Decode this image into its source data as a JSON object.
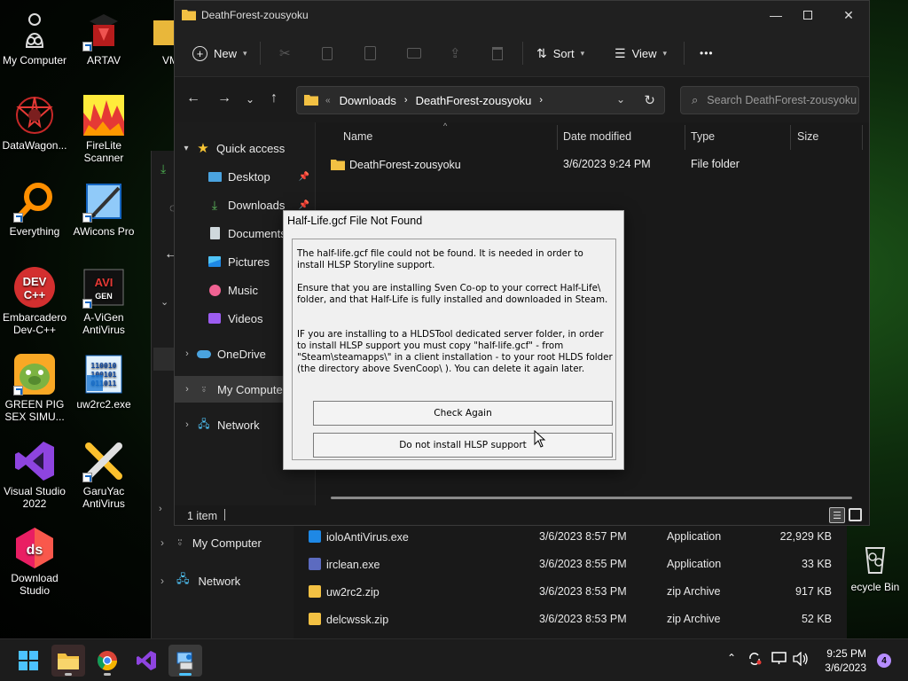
{
  "desktop": {
    "icons": [
      {
        "label": "My Computer"
      },
      {
        "label": "ARTAV"
      },
      {
        "label": "VM"
      },
      {
        "label": "DataWagon..."
      },
      {
        "label": "FireLite Scanner"
      },
      {
        "label": "Everything"
      },
      {
        "label": "AWicons Pro"
      },
      {
        "label": "Embarcadero Dev-C++"
      },
      {
        "label": "A-ViGen AntiVirus"
      },
      {
        "label": "GREEN PIG SEX SIMU..."
      },
      {
        "label": "uw2rc2.exe"
      },
      {
        "label": "Visual Studio 2022"
      },
      {
        "label": "GaruYac AntiVirus"
      },
      {
        "label": "Download Studio"
      },
      {
        "label": "ecycle Bin"
      }
    ]
  },
  "bg_explorer": {
    "nav": [
      {
        "label": "My Computer"
      },
      {
        "label": "Network"
      }
    ],
    "rows": [
      {
        "name": "ioloAntiVirus.exe",
        "date": "3/6/2023 8:57 PM",
        "type": "Application",
        "size": "22,929 KB"
      },
      {
        "name": "irclean.exe",
        "date": "3/6/2023 8:55 PM",
        "type": "Application",
        "size": "33 KB"
      },
      {
        "name": "uw2rc2.zip",
        "date": "3/6/2023 8:53 PM",
        "type": "zip Archive",
        "size": "917 KB"
      },
      {
        "name": "delcwssk.zip",
        "date": "3/6/2023 8:53 PM",
        "type": "zip Archive",
        "size": "52 KB"
      }
    ]
  },
  "explorer": {
    "title": "DeathForest-zousyoku",
    "toolbar": {
      "new": "New",
      "sort": "Sort",
      "view": "View",
      "more": "•••"
    },
    "address": {
      "overflow": "«",
      "crumbs": [
        "Downloads",
        "DeathForest-zousyoku"
      ]
    },
    "search": {
      "placeholder": "Search DeathForest-zousyoku"
    },
    "nav": [
      {
        "label": "Quick access"
      },
      {
        "label": "Desktop"
      },
      {
        "label": "Downloads"
      },
      {
        "label": "Documents"
      },
      {
        "label": "Pictures"
      },
      {
        "label": "Music"
      },
      {
        "label": "Videos"
      },
      {
        "label": "OneDrive"
      },
      {
        "label": "My Computer"
      },
      {
        "label": "Network"
      }
    ],
    "columns": {
      "name": "Name",
      "date": "Date modified",
      "type": "Type",
      "size": "Size"
    },
    "rows": [
      {
        "name": "DeathForest-zousyoku",
        "date": "3/6/2023 9:24 PM",
        "type": "File folder",
        "size": ""
      }
    ],
    "status": "1 item"
  },
  "dialog": {
    "title": "Half-Life.gcf File Not Found",
    "p1": "The half-life.gcf file could not be found. It is needed in order to install HLSP Storyline support.",
    "p2": "Ensure that you are installing Sven Co-op to your correct Half-Life\\ folder, and that Half-Life is fully installed and downloaded in Steam.",
    "p3": "IF you are installing to a HLDSTool dedicated server folder, in order to install HLSP support you must copy \"half-life.gcf\" - from \"Steam\\steamapps\\\" in a client installation - to your root HLDS folder (the directory above SvenCoop\\ ). You can delete it again later.",
    "btn_check": "Check Again",
    "btn_skip": "Do not install HLSP support"
  },
  "taskbar": {
    "time": "9:25 PM",
    "date": "3/6/2023",
    "notifications": "4"
  },
  "colors": {
    "accent": "#0078d4",
    "folder": "#f3c143",
    "dialog_bg": "#f0f0f0"
  }
}
